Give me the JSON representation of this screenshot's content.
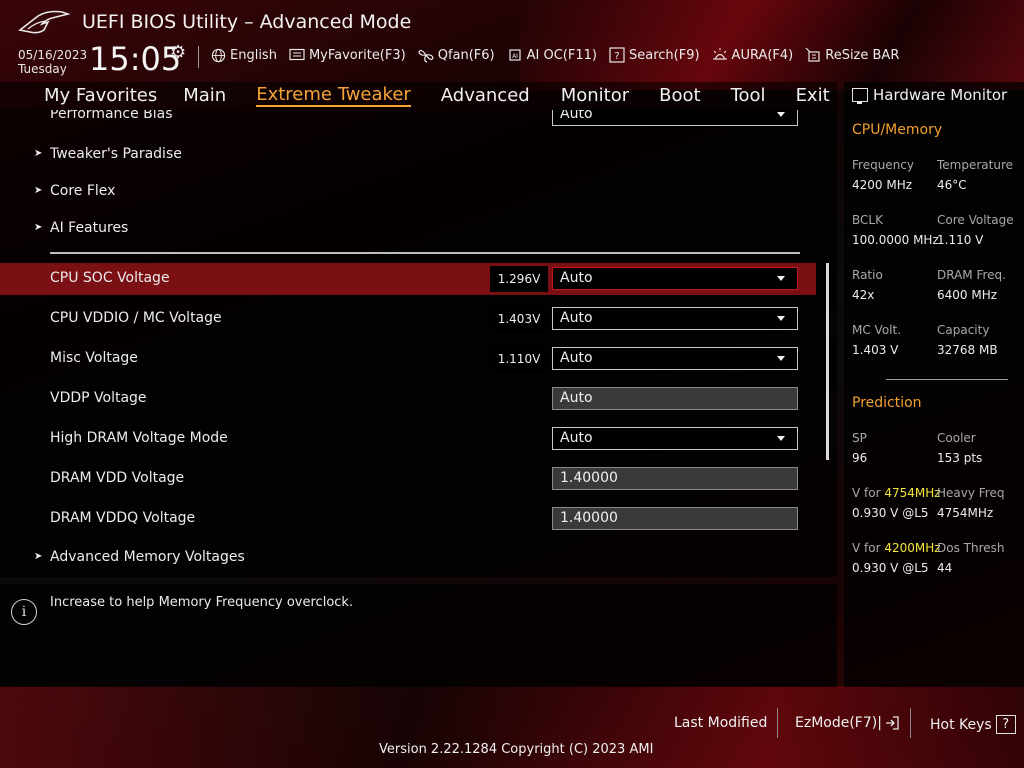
{
  "header": {
    "title": "UEFI BIOS Utility – Advanced Mode",
    "date": "05/16/2023",
    "day": "Tuesday",
    "time": "15:05"
  },
  "toolbar": [
    {
      "label": "English",
      "icon": "globe-icon"
    },
    {
      "label": "MyFavorite(F3)",
      "icon": "favorite-icon"
    },
    {
      "label": "Qfan(F6)",
      "icon": "fan-icon"
    },
    {
      "label": "AI OC(F11)",
      "icon": "ai-chip-icon"
    },
    {
      "label": "Search(F9)",
      "icon": "search-icon"
    },
    {
      "label": "AURA(F4)",
      "icon": "aura-light-icon"
    },
    {
      "label": "ReSize BAR",
      "icon": "resize-bar-icon"
    }
  ],
  "nav": {
    "tabs": [
      "My Favorites",
      "Main",
      "Extreme Tweaker",
      "Advanced",
      "Monitor",
      "Boot",
      "Tool",
      "Exit"
    ],
    "active": "Extreme Tweaker"
  },
  "settings": {
    "partial_label": "Performance Bias",
    "partial_value": "Auto",
    "submenus": [
      "Tweaker's Paradise",
      "Core Flex",
      "AI Features"
    ],
    "rows": [
      {
        "label": "CPU SOC Voltage",
        "reading": "1.296V",
        "value": "Auto"
      },
      {
        "label": "CPU VDDIO / MC Voltage",
        "reading": "1.403V",
        "value": "Auto"
      },
      {
        "label": "Misc Voltage",
        "reading": "1.110V",
        "value": "Auto"
      },
      {
        "label": "VDDP Voltage",
        "value": "Auto"
      },
      {
        "label": "High DRAM Voltage Mode",
        "value": "Auto"
      },
      {
        "label": "DRAM VDD Voltage",
        "value": "1.40000"
      },
      {
        "label": "DRAM VDDQ Voltage",
        "value": "1.40000"
      }
    ],
    "last_submenu": "Advanced Memory Voltages"
  },
  "help": {
    "text": "Increase to help Memory Frequency overclock."
  },
  "hardware_monitor": {
    "title": "Hardware Monitor",
    "cpu_memory_title": "CPU/Memory",
    "frequency_label": "Frequency",
    "frequency": "4200 MHz",
    "temperature_label": "Temperature",
    "temperature": "46°C",
    "bclk_label": "BCLK",
    "bclk": "100.0000 MHz",
    "core_voltage_label": "Core Voltage",
    "core_voltage": "1.110 V",
    "ratio_label": "Ratio",
    "ratio": "42x",
    "dram_freq_label": "DRAM Freq.",
    "dram_freq": "6400 MHz",
    "mc_volt_label": "MC Volt.",
    "mc_volt": "1.403 V",
    "capacity_label": "Capacity",
    "capacity": "32768 MB",
    "prediction_title": "Prediction",
    "sp_label": "SP",
    "sp": "96",
    "cooler_label": "Cooler",
    "cooler": "153 pts",
    "vfor_prefix": "V for ",
    "vfor1_freq": "4754MHz",
    "vfor1_value": "0.930 V @L5",
    "heavy_freq_label": "Heavy Freq",
    "heavy_freq": "4754MHz",
    "vfor2_freq": "4200MHz",
    "vfor2_value": "0.930 V @L5",
    "dos_thresh_label": "Dos Thresh",
    "dos_thresh": "44"
  },
  "footer": {
    "last_modified": "Last Modified",
    "ezmode": "EzMode(F7)|",
    "hotkeys": "Hot Keys",
    "hotkeys_key": "?",
    "version": "Version 2.22.1284 Copyright (C) 2023 AMI"
  },
  "colors": {
    "accent": "#f4a338",
    "highlight_row": "#7a0f14",
    "prediction_freq": "#f3e53a"
  }
}
